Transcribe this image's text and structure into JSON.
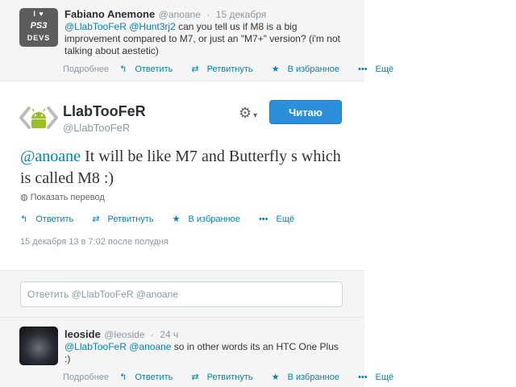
{
  "tweet1": {
    "avatar_text": {
      "line1": "I ♥",
      "line2": "PS3",
      "line3": "DEVS"
    },
    "name": "Fabiano Anemone",
    "handle": "@anoane",
    "time": "15 декабря",
    "text_mentions": "@LlabTooFeR @Hunt3rj2",
    "text_body": " can you tell us if M8 is a big improvement compared to M7, or just an \"M7+\" version? (i'm not talking about aestetic)",
    "actions": {
      "details": "Подробнее",
      "reply": "Ответить",
      "retweet": "Ретвитнуть",
      "favorite": "В избранное",
      "more": "Ещё"
    }
  },
  "main": {
    "name": "LlabTooFeR",
    "handle": "@LlabTooFeR",
    "follow_label": "Читаю",
    "text_mention": "@anoane",
    "text_body": " It will be like M7 and Butterfly s which is called M8 :)",
    "translate": "Показать перевод",
    "actions": {
      "reply": "Ответить",
      "retweet": "Ретвитнуть",
      "favorite": "В избранное",
      "more": "Ещё"
    },
    "timestamp": "15 декабря 13 в 7:02 после полудня"
  },
  "reply": {
    "placeholder": "Ответить @LlabTooFeR @anoane"
  },
  "tweet2": {
    "name": "leoside",
    "handle": "@leoside",
    "time": "24 ч",
    "text_mentions": "@LlabTooFeR @anoane",
    "text_body": " so in other words its an HTC One Plus :)",
    "actions": {
      "details": "Подробнее",
      "reply": "Ответить",
      "retweet": "Ретвитнуть",
      "favorite": "В избранное",
      "more": "Ещё"
    }
  },
  "colors": {
    "link": "#0084b4",
    "follow_button": "#2b90d9",
    "panel_bg": "#f5f5f5"
  }
}
